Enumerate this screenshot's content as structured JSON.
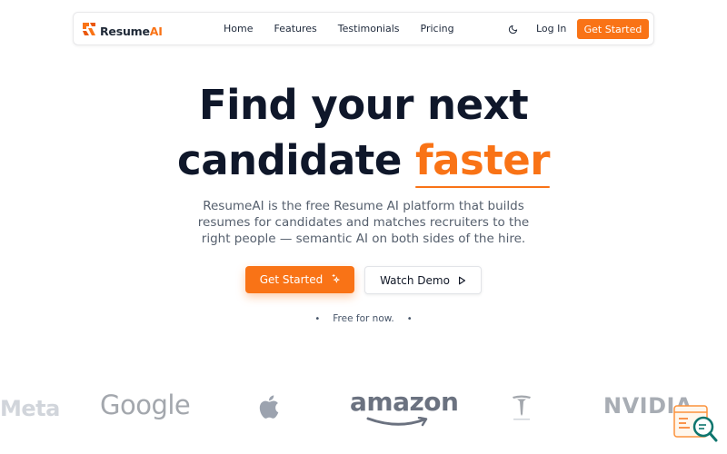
{
  "brand": {
    "name_part1": "Resume",
    "name_part2": "AI",
    "accent": "#f97316"
  },
  "nav": {
    "links": [
      "Home",
      "Features",
      "Testimonials",
      "Pricing"
    ],
    "login": "Log In",
    "cta": "Get Started"
  },
  "hero": {
    "title_line1": "Find your next",
    "title_line2_plain": "candidate",
    "title_line2_highlight": "faster",
    "subtitle": "ResumeAI is the free Resume AI platform that builds resumes for candidates and matches recruiters to the right people — semantic AI on both sides of the hire.",
    "primary_cta": "Get Started",
    "secondary_cta": "Watch Demo",
    "note": "Free for now."
  },
  "logos": {
    "meta": "Meta",
    "google": "Google",
    "amazon": "amazon",
    "nvidia": "NVIDIA"
  },
  "icons": {
    "theme": "moon-icon",
    "spark": "sparkle-icon",
    "play": "play-icon",
    "widget": "search-document-icon"
  }
}
